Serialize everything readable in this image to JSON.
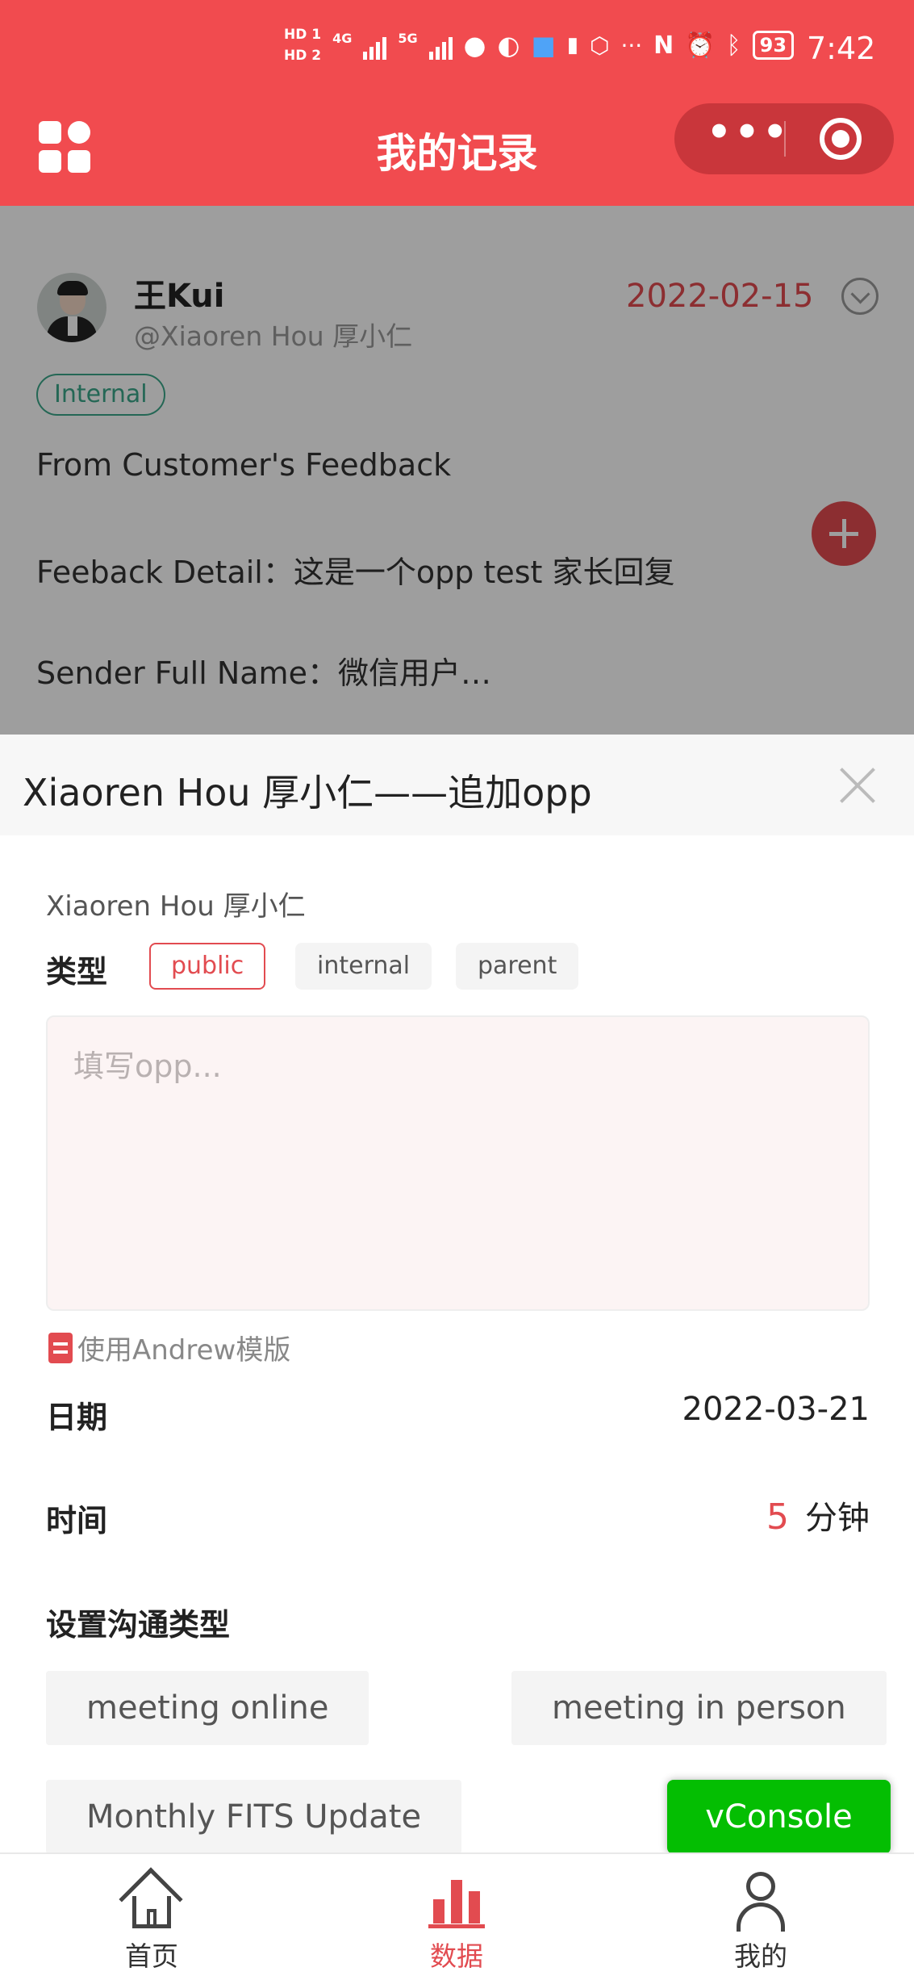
{
  "status_bar": {
    "hd1": "HD 1",
    "hd2": "HD 2",
    "net1": "4G",
    "net2": "5G",
    "more": "···",
    "battery": "93",
    "time": "7:42"
  },
  "header": {
    "title": "我的记录",
    "menu_icon": "grid-icon",
    "more_icon": "more-dots-icon",
    "close_icon": "target-icon"
  },
  "record": {
    "user_name": "王Kui",
    "handle": "@Xiaoren Hou 厚小仁",
    "date": "2022-02-15",
    "tag": "Internal",
    "line1": "From Customer's Feedback",
    "line2": "Feeback Detail：这是一个opp test 家长回复",
    "line3": "Sender Full Name：微信用户…"
  },
  "sheet": {
    "title": "Xiaoren Hou 厚小仁——追加opp",
    "owner": "Xiaoren Hou 厚小仁",
    "type_label": "类型",
    "types": [
      "public",
      "internal",
      "parent"
    ],
    "selected_type": "public",
    "input_placeholder": "填写opp...",
    "input_value": "",
    "template_link": "使用Andrew模版",
    "date_label": "日期",
    "date_value": "2022-03-21",
    "time_label": "时间",
    "duration_value": "5",
    "duration_unit": "分钟",
    "comm_type_label": "设置沟通类型",
    "comm_types": [
      "meeting online",
      "meeting in person",
      "Monthly FITS Update"
    ]
  },
  "vconsole_label": "vConsole",
  "tabbar": {
    "items": [
      {
        "label": "首页",
        "icon": "home-icon"
      },
      {
        "label": "数据",
        "icon": "bar-chart-icon",
        "active": true
      },
      {
        "label": "我的",
        "icon": "user-icon"
      }
    ]
  },
  "colors": {
    "brand_red": "#f14b4f",
    "accent_red": "#e24b50",
    "tag_green": "#3aa789",
    "vconsole_green": "#04be02"
  }
}
